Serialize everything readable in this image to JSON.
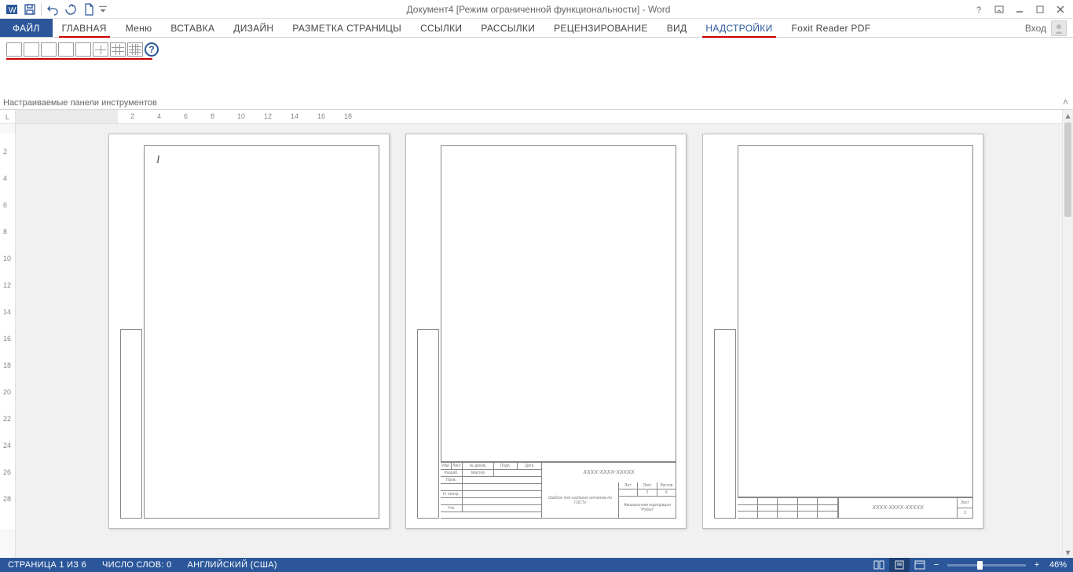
{
  "title": "Документ4 [Режим ограниченной функциональности] - Word",
  "signin_label": "Вход",
  "tabs": {
    "file": "ФАЙЛ",
    "home": "ГЛАВНАЯ",
    "menu": "Меню",
    "insert": "ВСТАВКА",
    "design": "ДИЗАЙН",
    "layout": "РАЗМЕТКА СТРАНИЦЫ",
    "references": "ССЫЛКИ",
    "mailings": "РАССЫЛКИ",
    "review": "РЕЦЕНЗИРОВАНИЕ",
    "view": "ВИД",
    "addins": "НАДСТРОЙКИ",
    "foxit": "Foxit Reader PDF"
  },
  "ribbon_group_label": "Настраиваемые панели инструментов",
  "ruler_marks": [
    "2",
    "4",
    "6",
    "8",
    "10",
    "12",
    "14",
    "16",
    "18"
  ],
  "vruler_marks": [
    "2",
    "4",
    "6",
    "8",
    "10",
    "12",
    "14",
    "16",
    "18",
    "20",
    "22",
    "24",
    "26",
    "28"
  ],
  "page1_cursor": "I",
  "titleblock": {
    "code": "XXXX-XXXX-XXXXX",
    "template_text": "Шаблон для создания отчетов по ГОСТу",
    "org": "Авиационная корпорация \"Рубин\"",
    "headers": {
      "lit": "Лит.",
      "list": "Лист",
      "listov": "Листов"
    },
    "values": {
      "list": "2",
      "listov": "6"
    },
    "left_labels": [
      "Изм.",
      "Лист",
      "№ докум.",
      "Подп.",
      "Дата",
      "Разраб.",
      "Пров.",
      "Н. контр.",
      "Утв.",
      "Мастер"
    ]
  },
  "titleblock_small": {
    "code": "XXXX-XXXX-XXXXX",
    "list_label": "Лист",
    "list_value": "3"
  },
  "status": {
    "page": "СТРАНИЦА 1 ИЗ 6",
    "words": "ЧИСЛО СЛОВ: 0",
    "lang": "АНГЛИЙСКИЙ (США)",
    "zoom": "46%"
  }
}
